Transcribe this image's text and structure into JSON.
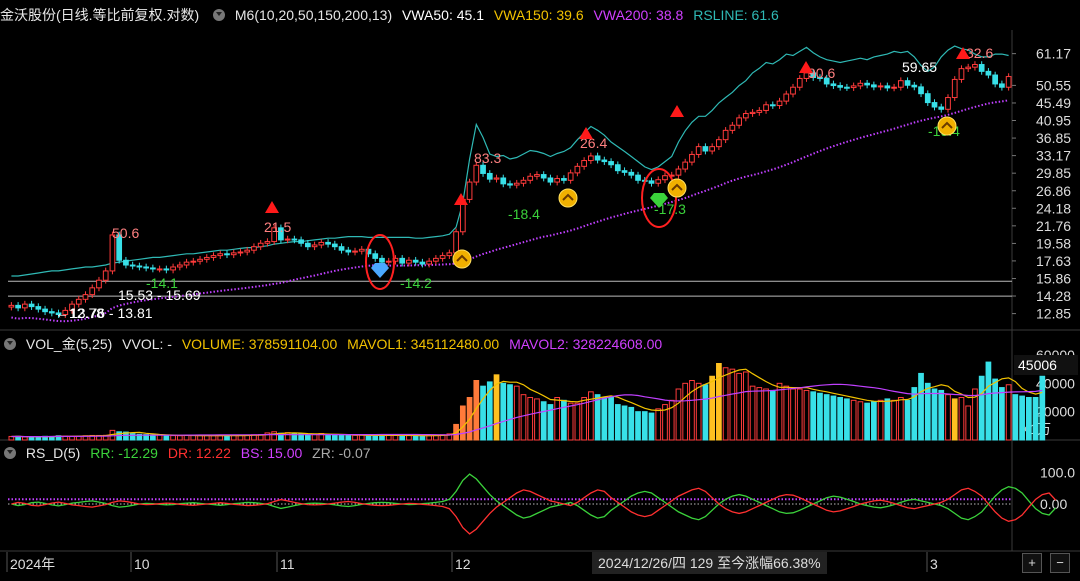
{
  "header_main": {
    "title": "金沃股份(日线.等比前复权.对数)",
    "ma_label": "M6(10,20,50,150,200,13)",
    "vwa50": "VWA50: 45.1",
    "vwa150": "VWA150: 39.6",
    "vwa200": "VWA200: 38.8",
    "rsline": "RSLINE: 61.6"
  },
  "header_vol": {
    "title": "VOL_金(5,25)",
    "vvol": "VVOL: -",
    "volume": "VOLUME: 378591104.00",
    "mavol1": "MAVOL1: 345112480.00",
    "mavol2": "MAVOL2: 328224608.00"
  },
  "header_rs": {
    "title": "RS_D(5)",
    "rr": "RR: -12.29",
    "dr": "DR: 12.22",
    "bs": "BS: 15.00",
    "zr": "ZR: -0.07"
  },
  "colors": {
    "up": "#ff3b3b",
    "down": "#38e0e8",
    "rsline": "#2fb9b5",
    "ma": "#c040ff",
    "vwa50": "#ffffff",
    "vwa150": "#f2c200",
    "vwa200": "#d040ff",
    "rr": "#3bd23b",
    "dr": "#ff3030",
    "vol_orange": "#ff7a3a",
    "vol_yellow": "#ffc020"
  },
  "icons": [
    "collapse-arrow-icon",
    "signal-up-triangle-icon",
    "diamond-icon",
    "sun-arrow-icon"
  ],
  "chart_data": [
    {
      "type": "candlestick",
      "scale": "log",
      "y_ticks": [
        "61.17",
        "50.55",
        "45.49",
        "40.95",
        "36.85",
        "33.17",
        "29.85",
        "26.86",
        "24.18",
        "21.76",
        "19.58",
        "17.63",
        "15.86",
        "14.28",
        "12.85"
      ],
      "ylim": [
        12.0,
        68.0
      ],
      "x_ticks": [
        "2024年",
        "10",
        "11",
        "12",
        "3"
      ],
      "series": [
        {
          "name": "收盘",
          "values": [
            13.5,
            13.3,
            13.6,
            13.4,
            13.2,
            13.0,
            12.9,
            12.78,
            13.1,
            13.6,
            14.0,
            14.4,
            15.0,
            15.7,
            16.6,
            20.6,
            17.7,
            17.2,
            17.1,
            17.0,
            16.9,
            16.8,
            16.8,
            16.7,
            17.0,
            17.2,
            17.5,
            17.6,
            17.8,
            18.0,
            18.2,
            18.4,
            18.3,
            18.5,
            18.6,
            18.8,
            19.2,
            19.6,
            19.8,
            21.5,
            20.0,
            20.1,
            20.0,
            19.6,
            19.2,
            19.4,
            19.7,
            19.5,
            19.2,
            18.8,
            18.6,
            18.7,
            18.9,
            18.4,
            17.9,
            17.5,
            17.6,
            17.9,
            17.4,
            17.7,
            17.5,
            17.3,
            17.6,
            17.9,
            18.2,
            18.5,
            21.0,
            25.5,
            28.3,
            31.3,
            29.8,
            28.8,
            29.0,
            28.0,
            27.8,
            28.1,
            28.6,
            29.3,
            29.6,
            29.0,
            28.3,
            28.9,
            28.6,
            29.9,
            31.1,
            32.2,
            33.1,
            32.3,
            32.0,
            31.4,
            30.3,
            30.0,
            29.5,
            28.6,
            28.5,
            28.1,
            28.7,
            29.4,
            29.5,
            30.6,
            31.9,
            33.4,
            35.0,
            34.1,
            35.0,
            36.5,
            38.6,
            39.8,
            41.6,
            42.7,
            43.0,
            43.5,
            45.0,
            44.8,
            46.0,
            48.0,
            50.0,
            52.7,
            54.5,
            53.0,
            52.8,
            51.0,
            50.5,
            50.0,
            49.9,
            50.4,
            51.2,
            50.7,
            50.1,
            50.4,
            49.8,
            50.0,
            52.0,
            50.6,
            50.1,
            48.1,
            45.6,
            44.4,
            43.8,
            47.0,
            52.4,
            55.9,
            56.4,
            57.3,
            55.0,
            53.8,
            51.0,
            50.0,
            53.3
          ]
        },
        {
          "name": "RSLINE",
          "values": [
            16.1,
            16.1,
            16.2,
            16.3,
            16.4,
            16.5,
            16.6,
            16.6,
            16.7,
            16.8,
            16.9,
            17.0,
            17.0,
            17.1,
            17.2,
            17.4,
            17.5,
            17.6,
            17.7,
            17.8,
            17.9,
            18.0,
            18.0,
            18.1,
            18.2,
            18.3,
            18.4,
            18.4,
            18.5,
            18.6,
            18.7,
            18.8,
            18.8,
            18.9,
            19.0,
            19.1,
            19.1,
            19.2,
            19.3,
            19.5,
            19.6,
            19.7,
            19.8,
            19.8,
            19.9,
            20.0,
            20.1,
            20.2,
            20.2,
            20.3,
            20.4,
            20.4,
            20.4,
            20.3,
            20.3,
            20.3,
            20.3,
            20.3,
            20.3,
            20.3,
            20.2,
            20.2,
            20.3,
            20.4,
            20.5,
            20.7,
            21.6,
            25.0,
            32.5,
            40.0,
            37.0,
            33.5,
            33.0,
            33.2,
            32.5,
            32.8,
            33.5,
            34.2,
            34.0,
            33.6,
            33.0,
            33.6,
            34.0,
            34.8,
            36.5,
            38.0,
            39.5,
            38.6,
            37.5,
            36.0,
            35.0,
            34.0,
            33.0,
            32.0,
            31.0,
            30.5,
            31.0,
            32.0,
            33.0,
            36.0,
            38.5,
            40.5,
            42.0,
            42.0,
            43.5,
            45.5,
            47.0,
            48.5,
            50.5,
            52.0,
            54.5,
            56.0,
            58.0,
            57.5,
            59.0,
            61.0,
            60.5,
            62.0,
            63.5,
            61.5,
            60.0,
            59.0,
            58.5,
            58.0,
            58.5,
            59.0,
            59.5,
            59.0,
            60.0,
            60.5,
            61.0,
            62.0,
            61.5,
            62.0,
            60.0,
            57.0,
            55.0,
            56.5,
            60.0,
            62.5,
            64.0,
            63.0,
            62.5,
            61.0,
            60.0,
            60.0,
            61.0,
            61.0,
            60.5
          ]
        }
      ],
      "annotations": [
        "50.6",
        "21.5",
        "83.3",
        "26.4",
        "90.6",
        "59.65",
        "32.6",
        "-14.1",
        "-14.2",
        "-18.4",
        "-17.3",
        "-19.4",
        "15.53 - 15.69",
        "13.76 - 13.81",
        "←12.78"
      ],
      "levels": [
        15.6,
        14.27
      ]
    },
    {
      "type": "bar",
      "y_ticks": [
        "60000",
        "40000",
        "20000"
      ],
      "unit": "X1万",
      "current": "45006",
      "ylim": [
        0,
        60000
      ],
      "values": [
        2500,
        2600,
        2200,
        2400,
        2300,
        2600,
        2500,
        3000,
        2800,
        2600,
        2700,
        3000,
        3200,
        3200,
        3300,
        6800,
        5800,
        5600,
        4500,
        4000,
        3800,
        3600,
        3600,
        3300,
        3100,
        3000,
        3200,
        3300,
        3100,
        3100,
        3000,
        3000,
        3100,
        3200,
        3400,
        3300,
        3700,
        3800,
        5000,
        5800,
        4800,
        5200,
        4300,
        4400,
        3900,
        4200,
        4600,
        3900,
        3700,
        3500,
        3200,
        3300,
        3400,
        3000,
        3200,
        3400,
        3400,
        3300,
        2900,
        3100,
        3200,
        2900,
        3000,
        3400,
        3700,
        4300,
        11000,
        24000,
        30000,
        42000,
        38000,
        41000,
        46000,
        40000,
        39000,
        38000,
        32000,
        30000,
        29000,
        27000,
        25000,
        30000,
        28000,
        26000,
        26000,
        30000,
        34000,
        32000,
        30000,
        30000,
        25000,
        24000,
        23000,
        20000,
        20000,
        19000,
        22000,
        25000,
        28000,
        36000,
        40000,
        42000,
        40000,
        39000,
        45000,
        54000,
        51000,
        50000,
        47000,
        48000,
        38000,
        37000,
        36000,
        35000,
        40000,
        38000,
        36000,
        36000,
        35000,
        34000,
        33000,
        32000,
        31000,
        30000,
        29000,
        28000,
        27000,
        26000,
        27000,
        28000,
        29000,
        28000,
        30000,
        28000,
        37000,
        47000,
        40000,
        36000,
        35000,
        32000,
        29000,
        30000,
        24000,
        36000,
        45000,
        55000,
        43000,
        37000,
        39000,
        32000,
        31000,
        30000,
        30000,
        45006
      ]
    },
    {
      "type": "line",
      "y_ticks": [
        "100.0",
        "0.00"
      ],
      "ylim": [
        -140,
        140
      ],
      "series": [
        {
          "name": "RR",
          "values": [
            0,
            -5,
            -2,
            4,
            6,
            2,
            -3,
            -6,
            -2,
            3,
            5,
            8,
            10,
            6,
            2,
            -5,
            -10,
            -8,
            -4,
            0,
            2,
            1,
            -1,
            -3,
            -2,
            1,
            3,
            4,
            2,
            0,
            -2,
            -4,
            -2,
            1,
            3,
            5,
            4,
            2,
            -1,
            -8,
            -14,
            -10,
            -5,
            -1,
            2,
            3,
            2,
            0,
            -3,
            -6,
            -8,
            -5,
            -1,
            2,
            4,
            5,
            4,
            2,
            0,
            -2,
            -1,
            1,
            3,
            5,
            8,
            15,
            40,
            75,
            95,
            80,
            55,
            30,
            10,
            -5,
            -20,
            -35,
            -45,
            -40,
            -30,
            -20,
            -10,
            -5,
            0,
            5,
            -5,
            -20,
            -35,
            -45,
            -40,
            -20,
            -5,
            10,
            25,
            35,
            40,
            35,
            20,
            5,
            -10,
            -25,
            -35,
            -45,
            -50,
            -40,
            -20,
            0,
            15,
            25,
            30,
            25,
            15,
            5,
            -5,
            -15,
            -25,
            -30,
            -28,
            -20,
            -10,
            0,
            10,
            20,
            25,
            22,
            15,
            8,
            0,
            -5,
            -10,
            -12,
            -8,
            -2,
            5,
            12,
            15,
            10,
            5,
            0,
            -5,
            -15,
            -30,
            -45,
            -50,
            -40,
            -25,
            0,
            25,
            45,
            55,
            50,
            35,
            10,
            -15,
            -30,
            -35,
            -12.29
          ]
        },
        {
          "name": "DR",
          "values": [
            0,
            5,
            2,
            -4,
            -6,
            -2,
            3,
            6,
            2,
            -3,
            -5,
            -8,
            -10,
            -6,
            -2,
            5,
            10,
            8,
            4,
            0,
            -2,
            -1,
            1,
            3,
            2,
            -1,
            -3,
            -4,
            -2,
            0,
            2,
            4,
            2,
            -1,
            -3,
            -5,
            -4,
            -2,
            1,
            8,
            14,
            10,
            5,
            1,
            -2,
            -3,
            -2,
            0,
            3,
            6,
            8,
            5,
            1,
            -2,
            -4,
            -5,
            -4,
            -2,
            0,
            2,
            1,
            -1,
            -3,
            -5,
            -8,
            -15,
            -40,
            -75,
            -95,
            -80,
            -55,
            -30,
            -10,
            5,
            20,
            35,
            45,
            40,
            30,
            20,
            10,
            5,
            0,
            -5,
            5,
            20,
            35,
            45,
            40,
            20,
            5,
            -10,
            -25,
            -35,
            -40,
            -35,
            -20,
            -5,
            10,
            25,
            35,
            45,
            50,
            40,
            20,
            0,
            -15,
            -25,
            -30,
            -25,
            -15,
            -5,
            5,
            15,
            25,
            30,
            28,
            20,
            10,
            0,
            -10,
            -20,
            -25,
            -22,
            -15,
            -8,
            0,
            5,
            10,
            12,
            8,
            2,
            -5,
            -12,
            -15,
            -10,
            -5,
            0,
            5,
            15,
            30,
            45,
            50,
            40,
            25,
            0,
            -25,
            -45,
            -55,
            -50,
            -35,
            -10,
            15,
            30,
            35,
            12.22
          ]
        }
      ],
      "reference_lines": [
        15.0,
        -0.07
      ]
    }
  ]
}
